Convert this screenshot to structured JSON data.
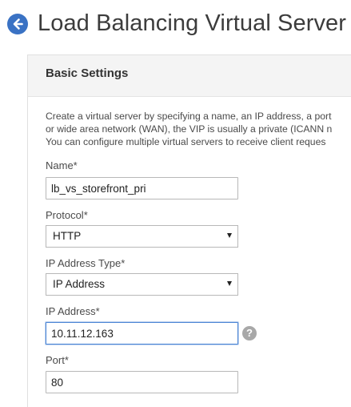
{
  "header": {
    "title": "Load Balancing Virtual Server",
    "back_icon": "back-arrow-circle-icon",
    "accent_color": "#3a72c4"
  },
  "panel": {
    "title": "Basic Settings",
    "description_lines": [
      "Create a virtual server by specifying a name, an IP address, a port",
      "or wide area network (WAN), the VIP is usually a private (ICANN n",
      "You can configure multiple virtual servers to receive client reques"
    ]
  },
  "form": {
    "name": {
      "label": "Name*",
      "value": "lb_vs_storefront_pri"
    },
    "protocol": {
      "label": "Protocol*",
      "selected": "HTTP"
    },
    "ip_address_type": {
      "label": "IP Address Type*",
      "selected": "IP Address"
    },
    "ip_address": {
      "label": "IP Address*",
      "value": "10.11.12.163",
      "help_icon": "question-mark-icon",
      "help_glyph": "?"
    },
    "port": {
      "label": "Port*",
      "value": "80"
    }
  }
}
